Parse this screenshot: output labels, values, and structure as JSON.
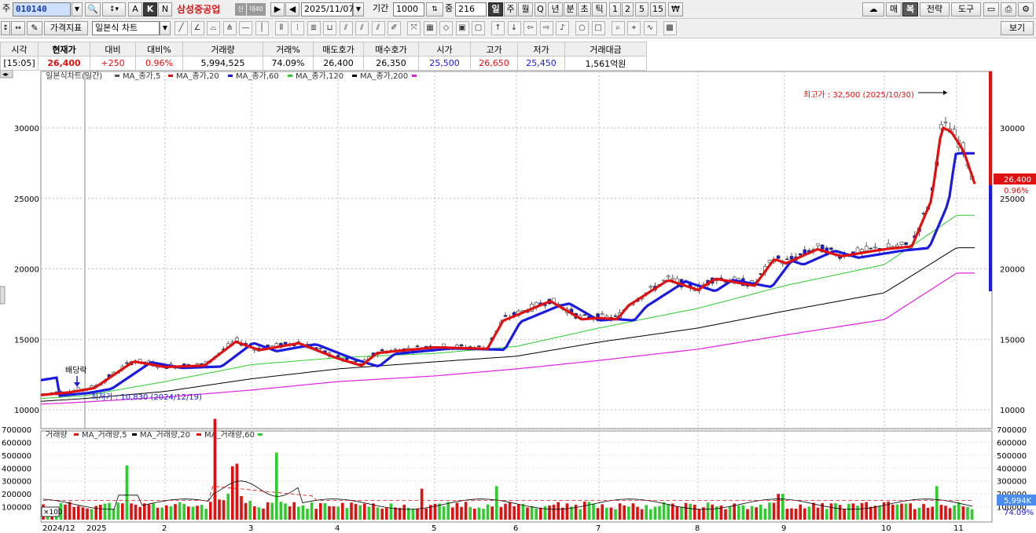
{
  "toolbar": {
    "code_label": "주",
    "code": "010140",
    "grid_btns": [
      "A",
      "K",
      "N"
    ],
    "stock_name": "삼성중공업",
    "badge1": "신",
    "badge2": "대40",
    "date": "2025/11/07",
    "period_label": "기간",
    "period": "1000",
    "count_label": "중",
    "count": "216",
    "periods": [
      "일",
      "주",
      "월",
      "Q",
      "년",
      "분",
      "초",
      "틱",
      "1",
      "2",
      "5",
      "15",
      "₩"
    ],
    "right_btns": [
      "매",
      "복",
      "전략",
      "도구"
    ],
    "indicator_btn": "가격지표",
    "chart_type": "일본식 차트",
    "view_btn": "보기"
  },
  "quote": {
    "headers": [
      "시각",
      "현재가",
      "대비",
      "대비%",
      "거래량",
      "거래%",
      "매도호가",
      "매수호가",
      "시가",
      "고가",
      "저가",
      "거래대금"
    ],
    "values": [
      "[15:05]",
      "26,400",
      "+250",
      "0.96%",
      "5,994,525",
      "74.09%",
      "26,400",
      "26,350",
      "25,500",
      "26,650",
      "25,450",
      "1,561억원"
    ]
  },
  "chart": {
    "legend": [
      {
        "label": "일본식차트(일간)",
        "color": "#555555"
      },
      {
        "label": "MA_종가,5",
        "color": "#e01010"
      },
      {
        "label": "MA_종가,20",
        "color": "#1a1ae0"
      },
      {
        "label": "MA_종가,60",
        "color": "#2ecc2e"
      },
      {
        "label": "MA_종가,120",
        "color": "#000000"
      },
      {
        "label": "MA_종가,200",
        "color": "#e020e0"
      }
    ],
    "vol_legend": [
      {
        "label": "거래량",
        "color": "#e01010"
      },
      {
        "label": "MA_거래량,5",
        "color": "#000000"
      },
      {
        "label": "MA_거래량,20",
        "color": "#e01010"
      },
      {
        "label": "MA_거래량,60",
        "color": "#2ecc2e"
      }
    ],
    "price_ticks": [
      "30000",
      "25000",
      "20000",
      "15000",
      "10000"
    ],
    "vol_ticks": [
      "700000",
      "600000",
      "500000",
      "400000",
      "300000",
      "200000",
      "100000"
    ],
    "x_labels": [
      "2024/12",
      "2025",
      "2",
      "3",
      "4",
      "5",
      "6",
      "7",
      "8",
      "9",
      "10",
      "11"
    ],
    "high_note": "최고가 : 32,500 (2025/10/30)",
    "low_note": "최저가 : 10,830 (2024/12/19)",
    "dividend_note": "배당락",
    "current_price": "26,400",
    "current_pct": "0.96%",
    "current_vol": "5,994K",
    "vol_pct": "74.09%",
    "vol_scale": "×100",
    "colors": {
      "up": "#e01010",
      "down": "#1a1ae0",
      "vol_up": "#e01010",
      "vol_down": "#2ecc2e"
    }
  },
  "chart_data": {
    "type": "candlestick",
    "x": [
      "2024/12",
      "2025",
      "2",
      "3",
      "4",
      "5",
      "6",
      "7",
      "8",
      "9",
      "10",
      "11"
    ],
    "series": [
      {
        "name": "MA_종가,5",
        "values": [
          11000,
          11600,
          13000,
          14500,
          13600,
          14500,
          16500,
          16500,
          19000,
          21500,
          22000,
          29000
        ]
      },
      {
        "name": "MA_종가,20",
        "values": [
          10900,
          11400,
          12900,
          14200,
          13800,
          14400,
          15500,
          16800,
          18500,
          20800,
          21800,
          27000
        ]
      },
      {
        "name": "MA_종가,60",
        "values": [
          10800,
          11000,
          12000,
          13200,
          13700,
          14000,
          14500,
          15800,
          17200,
          18800,
          20300,
          23800
        ]
      },
      {
        "name": "MA_종가,120",
        "values": [
          10600,
          10800,
          11300,
          12200,
          12900,
          13400,
          13800,
          14800,
          15800,
          17000,
          18300,
          21500
        ]
      },
      {
        "name": "MA_종가,200",
        "values": [
          10400,
          10550,
          10900,
          11400,
          12000,
          12400,
          12900,
          13500,
          14300,
          15300,
          16400,
          19700
        ]
      }
    ],
    "ylim": [
      9000,
      33000
    ],
    "annotations": [
      "최고가 : 32,500 (2025/10/30)",
      "최저가 : 10,830 (2024/12/19)",
      "배당락"
    ],
    "volume_ylim": [
      0,
      700000
    ]
  }
}
